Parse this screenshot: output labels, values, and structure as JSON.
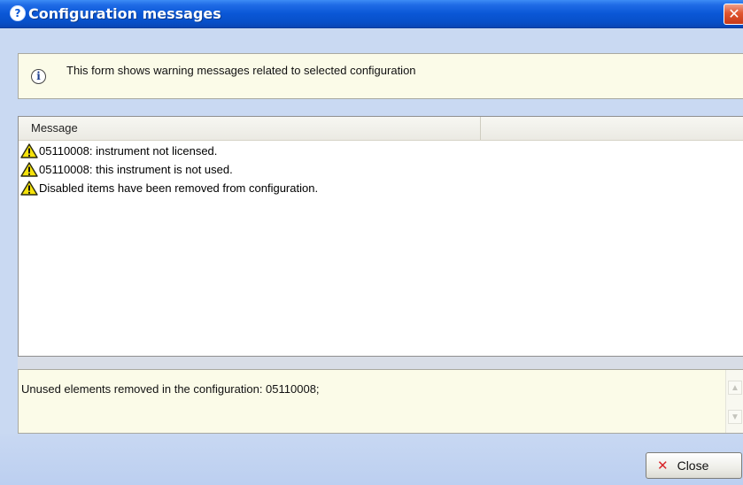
{
  "window": {
    "title": "Configuration messages",
    "title_icon_glyph": "?",
    "close_glyph": "✕"
  },
  "info": {
    "icon": "info-icon",
    "icon_glyph": "i",
    "text": "This form shows warning messages related to selected configuration"
  },
  "list": {
    "columns": [
      "Message",
      ""
    ],
    "rows": [
      {
        "icon": "warning-icon",
        "text": "05110008: instrument not licensed."
      },
      {
        "icon": "warning-icon",
        "text": "05110008: this instrument is not used."
      },
      {
        "icon": "warning-icon",
        "text": "Disabled items have been removed from configuration."
      }
    ]
  },
  "detail": {
    "text": "Unused elements removed in the configuration: 05110008;",
    "scroll_up_glyph": "▲",
    "scroll_down_glyph": "▼"
  },
  "footer": {
    "close_label": "Close",
    "close_icon_glyph": "✕"
  },
  "colors": {
    "titlebar": "#0a57d6",
    "panel_background": "#fbfbe8",
    "warning_fill": "#f5e20a",
    "close_accent": "#d8262a"
  }
}
